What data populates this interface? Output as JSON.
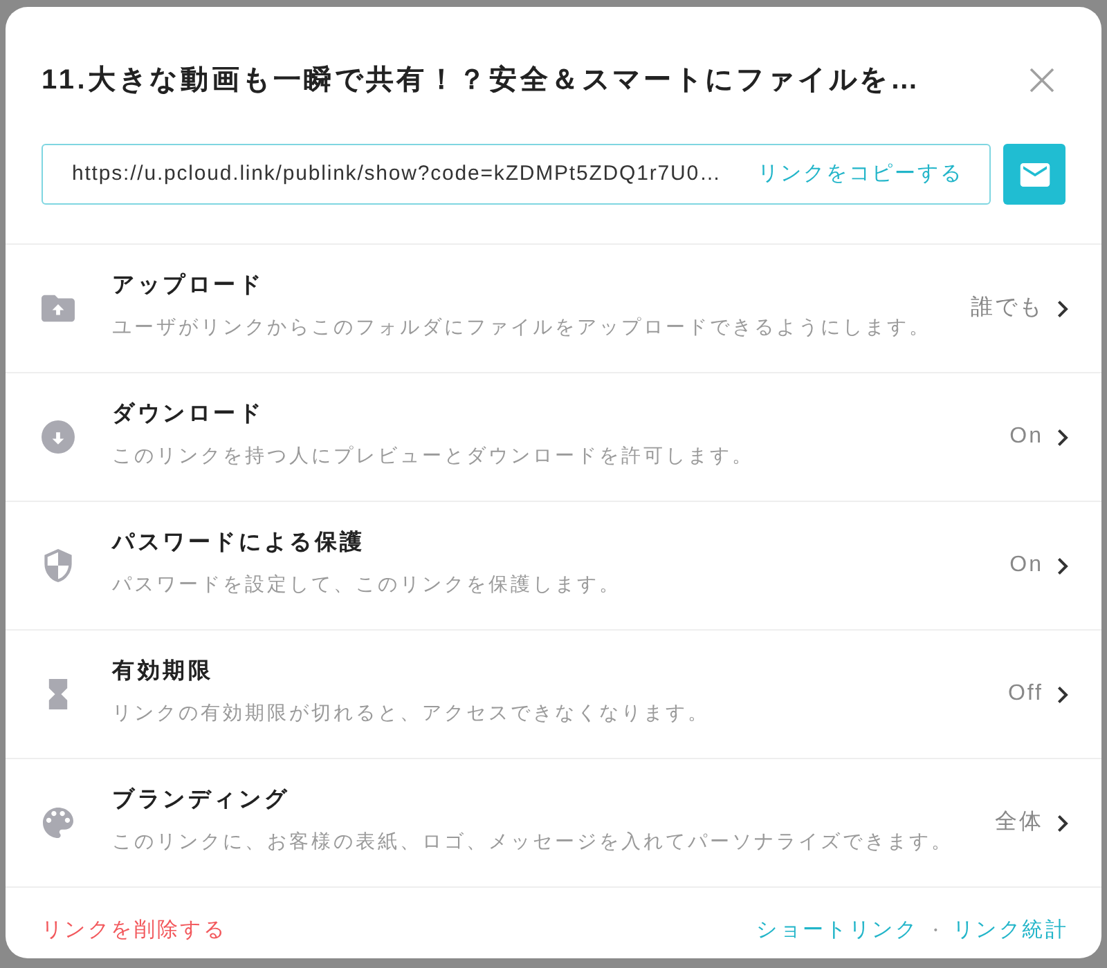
{
  "dialog": {
    "title": "11.大きな動画も一瞬で共有！？安全＆スマートにファイルを…"
  },
  "link": {
    "url": "https://u.pcloud.link/publink/show?code=kZDMPt5ZDQ1r7U0…",
    "copy_label": "リンクをコピーする"
  },
  "settings": [
    {
      "kind": "upload",
      "title": "アップロード",
      "description": "ユーザがリンクからこのフォルダにファイルをアップロードできるようにします。",
      "value": "誰でも"
    },
    {
      "kind": "download",
      "title": "ダウンロード",
      "description": "このリンクを持つ人にプレビューとダウンロードを許可します。",
      "value": "On"
    },
    {
      "kind": "password",
      "title": "パスワードによる保護",
      "description": "パスワードを設定して、このリンクを保護します。",
      "value": "On"
    },
    {
      "kind": "expiry",
      "title": "有効期限",
      "description": "リンクの有効期限が切れると、アクセスできなくなります。",
      "value": "Off"
    },
    {
      "kind": "branding",
      "title": "ブランディング",
      "description": "このリンクに、お客様の表紙、ロゴ、メッセージを入れてパーソナライズできます。",
      "value": "全体"
    }
  ],
  "footer": {
    "delete_label": "リンクを削除する",
    "links": [
      "ショートリンク",
      "リンク統計"
    ],
    "separator": "・"
  }
}
